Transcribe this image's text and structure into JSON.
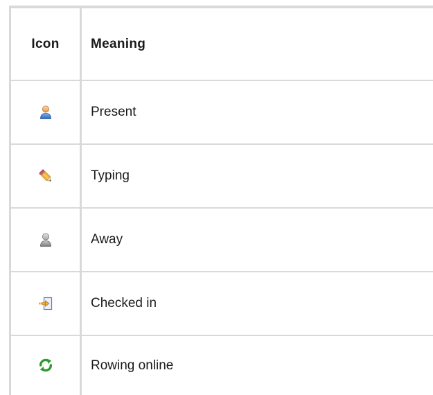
{
  "table": {
    "headers": {
      "icon": "Icon",
      "meaning": "Meaning"
    },
    "rows": [
      {
        "icon": "user-present-icon",
        "meaning": "Present"
      },
      {
        "icon": "pencil-typing-icon",
        "meaning": "Typing"
      },
      {
        "icon": "user-away-icon",
        "meaning": "Away"
      },
      {
        "icon": "checked-in-arrow-icon",
        "meaning": "Checked in"
      },
      {
        "icon": "green-refresh-icon",
        "meaning": "Rowing online"
      }
    ]
  },
  "colors": {
    "grid": "#d9d9d9",
    "present_head": "#f0a860",
    "present_body": "#3f86d8",
    "away": "#9a9a9a",
    "refresh": "#2e9a2e"
  }
}
